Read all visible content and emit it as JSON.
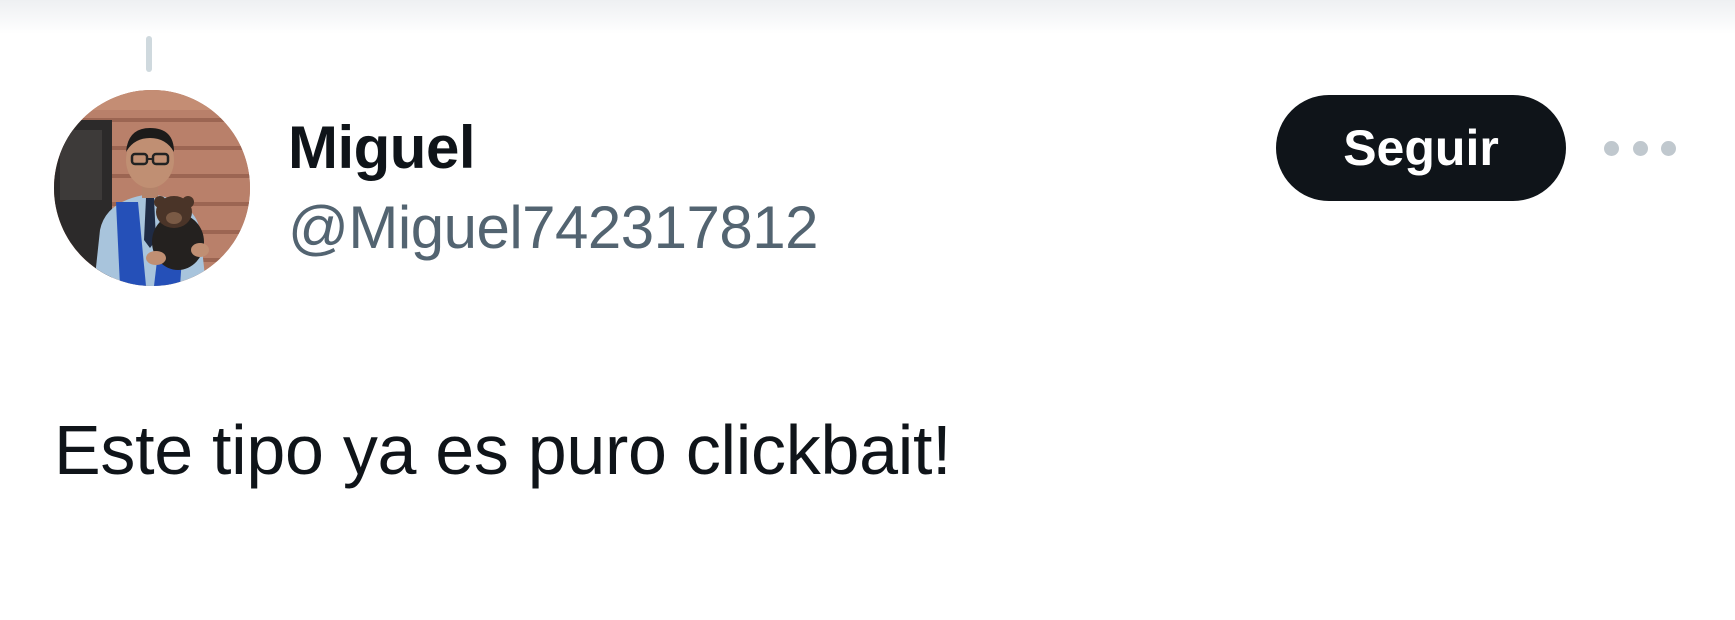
{
  "tweet": {
    "author": {
      "display_name": "Miguel",
      "handle": "@Miguel742317812",
      "avatar_icon": "user-photo-avatar"
    },
    "follow_label": "Seguir",
    "more_icon": "more-options-icon",
    "text": "Este tipo ya es puro clickbait!"
  },
  "colors": {
    "text_primary": "#0f1419",
    "text_secondary": "#536471",
    "button_bg": "#0f1419",
    "button_text": "#ffffff",
    "thread_line": "#cfd9de",
    "more_dots": "#c0c8ce"
  }
}
